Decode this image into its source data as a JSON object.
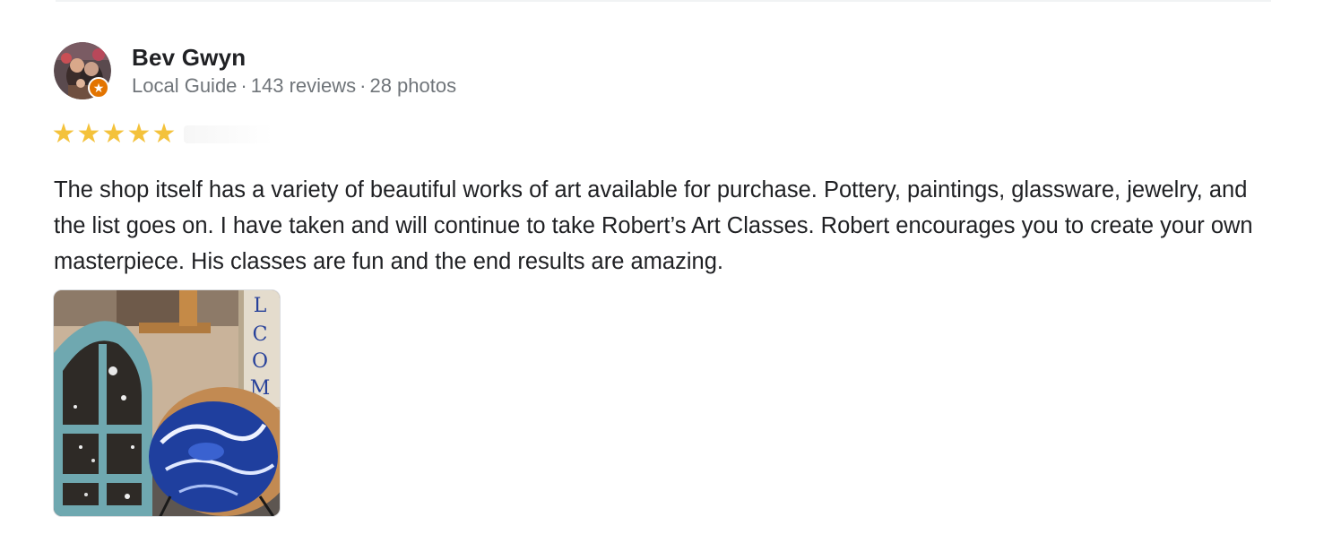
{
  "reviewer": {
    "name": "Bev Gwyn",
    "badge": "Local Guide",
    "reviews": "143 reviews",
    "photos": "28 photos",
    "separator": "·"
  },
  "rating": {
    "stars": 5,
    "max": 5,
    "color": "#f4c23b"
  },
  "review": {
    "text": "The shop itself has a variety of beautiful works of art available for purchase. Pottery, paintings, glassware, jewelry, and the list goes on. I have taken and will continue to take Robert’s Art Classes. Robert encourages you to create your own masterpiece. His classes are fun and the end results are amazing."
  },
  "photo": {
    "sign_letters": [
      "L",
      "C",
      "O",
      "M"
    ]
  },
  "icons": {
    "star": "star-icon",
    "badge": "local-guide-badge-icon"
  },
  "colors": {
    "name": "#202124",
    "meta": "#70757a",
    "badge": "#e37400"
  }
}
